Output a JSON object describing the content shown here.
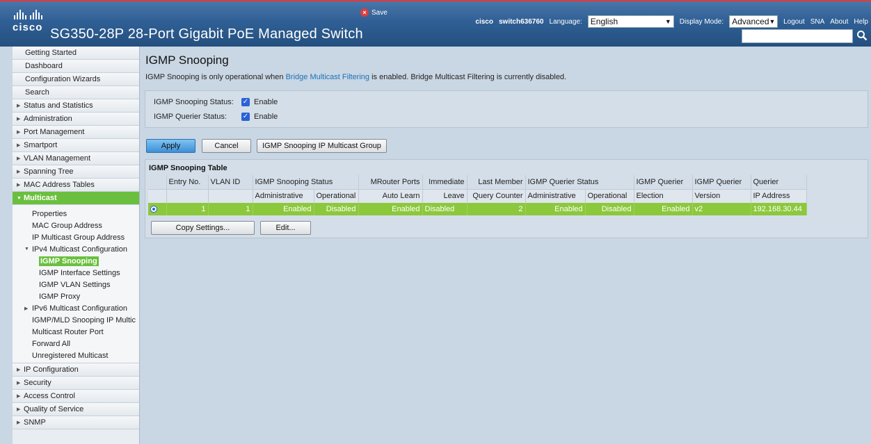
{
  "header": {
    "logo_text": "cisco",
    "product_title": "SG350-28P 28-Port Gigabit PoE Managed Switch",
    "save_label": "Save",
    "user": "cisco",
    "hostname": "switch636760",
    "language_label": "Language:",
    "language_value": "English",
    "display_mode_label": "Display Mode:",
    "display_mode_value": "Advanced",
    "logout": "Logout",
    "sna": "SNA",
    "about": "About",
    "help": "Help"
  },
  "sidebar": {
    "top_items": [
      "Getting Started",
      "Dashboard",
      "Configuration Wizards",
      "Search"
    ],
    "arrow_items_a": [
      "Status and Statistics",
      "Administration",
      "Port Management",
      "Smartport",
      "VLAN Management",
      "Spanning Tree",
      "MAC Address Tables"
    ],
    "active_item": "Multicast",
    "multicast_children": {
      "properties": "Properties",
      "mac_group": "MAC Group Address",
      "ip_group": "IP Multicast Group Address",
      "ipv4_folder": "IPv4 Multicast Configuration",
      "igmp_snooping": "IGMP Snooping",
      "igmp_interface": "IGMP Interface Settings",
      "igmp_vlan": "IGMP VLAN Settings",
      "igmp_proxy": "IGMP Proxy",
      "ipv6_folder": "IPv6 Multicast Configuration",
      "igmp_mld": "IGMP/MLD Snooping IP Multic",
      "mrouter": "Multicast Router Port",
      "forward_all": "Forward All",
      "unregistered": "Unregistered Multicast"
    },
    "arrow_items_b": [
      "IP Configuration",
      "Security",
      "Access Control",
      "Quality of Service",
      "SNMP"
    ]
  },
  "main": {
    "title": "IGMP Snooping",
    "notice_pre": "IGMP Snooping is only operational when ",
    "notice_link": "Bridge Multicast Filtering",
    "notice_post": " is enabled. Bridge Multicast Filtering is currently disabled.",
    "snooping_status_label": "IGMP Snooping Status:",
    "querier_status_label": "IGMP Querier Status:",
    "enable_label": "Enable",
    "apply": "Apply",
    "cancel": "Cancel",
    "group_button": "IGMP Snooping IP Multicast Group",
    "table_title": "IGMP Snooping Table",
    "columns": {
      "entry_no": "Entry No.",
      "vlan_id": "VLAN ID",
      "snoop_status": "IGMP Snooping Status",
      "administrative": "Administrative",
      "operational": "Operational",
      "mrouter_1": "MRouter Ports",
      "mrouter_2": "Auto Learn",
      "immediate_1": "Immediate",
      "immediate_2": "Leave",
      "last_member_1": "Last Member",
      "last_member_2": "Query Counter",
      "querier_status": "IGMP Querier Status",
      "q_election_1": "IGMP Querier",
      "q_election_2": "Election",
      "q_version_1": "IGMP Querier",
      "q_version_2": "Version",
      "q_ip_1": "Querier",
      "q_ip_2": "IP Address"
    },
    "row": {
      "entry_no": "1",
      "vlan_id": "1",
      "snoop_admin": "Enabled",
      "snoop_oper": "Disabled",
      "mrouter_auto": "Enabled",
      "immediate_leave": "Disabled",
      "query_counter": "2",
      "querier_admin": "Enabled",
      "querier_oper": "Disabled",
      "querier_election": "Enabled",
      "querier_version": "v2",
      "querier_ip": "192.168.30.44"
    },
    "copy_settings": "Copy Settings...",
    "edit": "Edit..."
  }
}
